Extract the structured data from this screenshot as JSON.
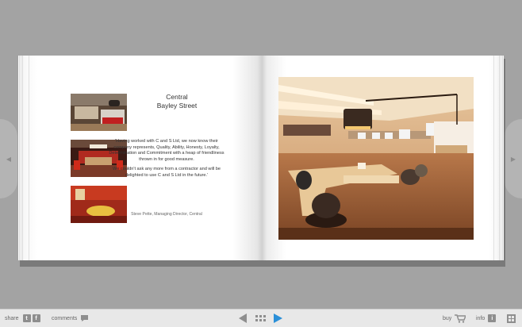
{
  "navigation": {
    "prev_glyph": "◀",
    "next_glyph": "▶"
  },
  "left_page": {
    "title_line1": "Central",
    "title_line2": "Bayley Street",
    "quote_p1": "'Having worked with C and S Ltd, we now know their company represents, Quality, Ability, Honesty, Loyalty, Determination and Commitment with a heap of friendliness thrown in for good measure.",
    "quote_p2": "We couldn't ask any more from a contractor and will be delighted to use C and S Ltd in the future.'",
    "signature": "Steve Pette, Managing Director, Central"
  },
  "toolbar": {
    "share_label": "share",
    "twitter_glyph": "t",
    "facebook_glyph": "f",
    "comments_label": "comments",
    "buy_label": "buy",
    "info_label": "info",
    "info_glyph": "i"
  },
  "colors": {
    "accent_play": "#2a8fd8",
    "background": "#a3a3a3"
  },
  "icons": [
    "comment-bubble-icon",
    "previous-page-icon",
    "grid-view-icon",
    "next-page-icon",
    "shopping-cart-icon",
    "info-icon",
    "fullscreen-icon",
    "twitter-icon",
    "facebook-icon"
  ]
}
